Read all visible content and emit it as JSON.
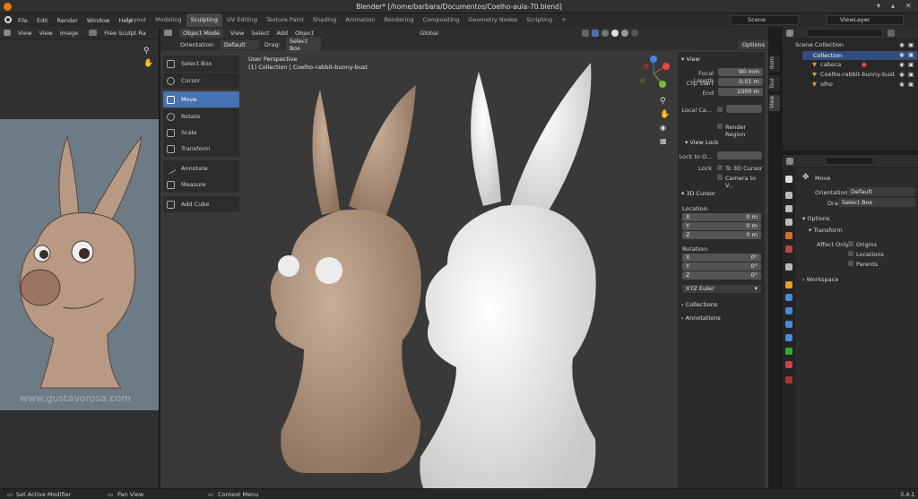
{
  "window": {
    "title": "Blender* [/home/barbara/Documentos/Coelho-aula-70.blend]"
  },
  "menu": [
    "File",
    "Edit",
    "Render",
    "Window",
    "Help"
  ],
  "workspaces": [
    "Layout",
    "Modeling",
    "Sculpting",
    "UV Editing",
    "Texture Paint",
    "Shading",
    "Animation",
    "Rendering",
    "Compositing",
    "Geometry Nodes",
    "Scripting"
  ],
  "active_workspace": "Sculpting",
  "scene": {
    "name": "Scene",
    "view_layer": "ViewLayer"
  },
  "image_editor": {
    "menus": [
      "View",
      "View",
      "Image"
    ],
    "brush": "Free Sculpt Ra",
    "watermark": "www.gustavorosa.com"
  },
  "viewport": {
    "mode": "Object Mode",
    "menus": [
      "View",
      "Select",
      "Add",
      "Object"
    ],
    "transform_orientation": "Global",
    "orientation_label": "Orientation:",
    "orientation_value": "Default",
    "drag_label": "Drag:",
    "drag_value": "Select Box",
    "options_label": "Options",
    "overlay_line1": "User Perspective",
    "overlay_line2": "(1) Collection | Coelho-rabbit-bunny-bust"
  },
  "toolbar": [
    "Select Box",
    "Cursor",
    "Move",
    "Rotate",
    "Scale",
    "Transform",
    "Annotate",
    "Measure",
    "Add Cube"
  ],
  "active_tool": "Move",
  "npanel": {
    "tabs": [
      "Item",
      "Tool",
      "View"
    ],
    "view_header": "View",
    "focal_length_label": "Focal Length",
    "focal_length": "90 mm",
    "clip_start_label": "Clip Start",
    "clip_start": "0.01 m",
    "end_label": "End",
    "end": "1000 m",
    "local_camera_label": "Local Ca...",
    "render_region_label": "Render Region",
    "view_lock_header": "View Lock",
    "lock_to_object_label": "Lock to O...",
    "lock_label": "Lock",
    "to_3d_cursor_label": "To 3D Cursor",
    "camera_to_view_label": "Camera to V...",
    "cursor_header": "3D Cursor",
    "location_label": "Location:",
    "rotation_label": "Rotation:",
    "location": [
      {
        "axis": "X",
        "value": "0 m"
      },
      {
        "axis": "Y",
        "value": "0 m"
      },
      {
        "axis": "Z",
        "value": "0 m"
      }
    ],
    "rotation": [
      {
        "axis": "X",
        "value": "0°"
      },
      {
        "axis": "Y",
        "value": "0°"
      },
      {
        "axis": "Z",
        "value": "0°"
      }
    ],
    "rotation_mode": "XYZ Euler",
    "collections_label": "Collections",
    "annotations_label": "Annotations"
  },
  "outliner": {
    "root": "Scene Collection",
    "collection": "Collection",
    "items": [
      "cabeca",
      "Coelho-rabbit-bunny-bust",
      "olho"
    ]
  },
  "properties": {
    "tool_name": "Move",
    "orientation_label": "Orientation",
    "orientation_value": "Default",
    "drag_label": "Drag:",
    "drag_value": "Select Box",
    "options_label": "Options",
    "transform_label": "Transform",
    "affect_only_label": "Affect Only",
    "affect_only": [
      "Origins",
      "Locations",
      "Parents"
    ],
    "workspace_label": "Workspace"
  },
  "status_bar": {
    "left": "Set Active Modifier",
    "middle": "Pan View",
    "right": "Context Menu",
    "version": "3.4.1"
  },
  "colors": {
    "accent": "#4772b3",
    "tan": "#a88b74",
    "white_model": "#e6e6e4"
  }
}
